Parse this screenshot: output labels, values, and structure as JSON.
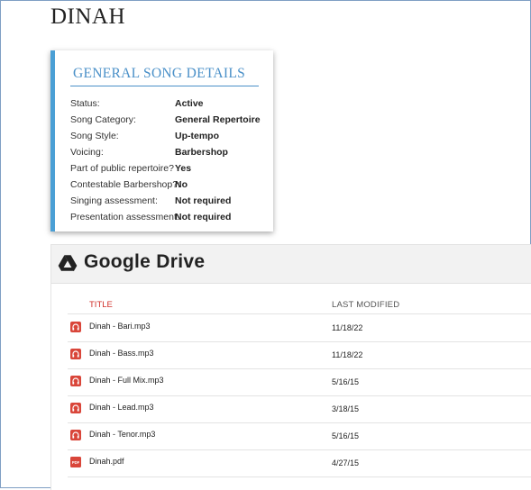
{
  "song": {
    "title": "DINAH"
  },
  "details": {
    "heading": "GENERAL SONG DETAILS",
    "rows": [
      {
        "label": "Status:",
        "value": "Active"
      },
      {
        "label": "Song Category:",
        "value": "General Repertoire"
      },
      {
        "label": "Song Style:",
        "value": "Up-tempo"
      },
      {
        "label": "Voicing:",
        "value": "Barbershop"
      },
      {
        "label": "Part of public repertoire?",
        "value": "Yes"
      },
      {
        "label": "Contestable Barbershop?:",
        "value": "No"
      },
      {
        "label": "Singing assessment:",
        "value": "Not required"
      },
      {
        "label": "Presentation assessment:",
        "value": "Not required"
      }
    ]
  },
  "drive": {
    "title": "Google Drive",
    "logo_icon": "google-drive-icon",
    "columns": {
      "title": "TITLE",
      "last_modified": "LAST MODIFIED"
    },
    "files": [
      {
        "name": "Dinah - Bari.mp3",
        "modified": "11/18/22",
        "icon": "audio-file-icon"
      },
      {
        "name": "Dinah - Bass.mp3",
        "modified": "11/18/22",
        "icon": "audio-file-icon"
      },
      {
        "name": "Dinah - Full Mix.mp3",
        "modified": "5/16/15",
        "icon": "audio-file-icon"
      },
      {
        "name": "Dinah - Lead.mp3",
        "modified": "3/18/15",
        "icon": "audio-file-icon"
      },
      {
        "name": "Dinah - Tenor.mp3",
        "modified": "5/16/15",
        "icon": "audio-file-icon"
      },
      {
        "name": "Dinah.pdf",
        "modified": "4/27/15",
        "icon": "pdf-file-icon",
        "icon_text": "PDF"
      }
    ]
  },
  "colors": {
    "accent_blue": "#4a9fd5",
    "heading_blue": "#4a90c8",
    "title_red": "#d0302a",
    "file_icon_red": "#d9463a"
  }
}
